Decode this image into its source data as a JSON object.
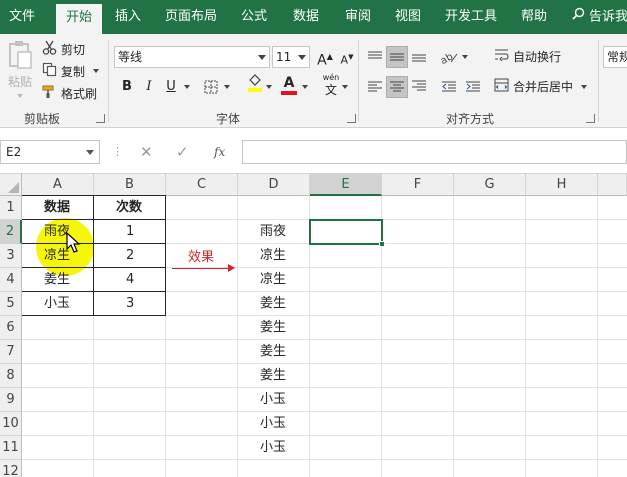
{
  "tabs": [
    "文件",
    "开始",
    "插入",
    "页面布局",
    "公式",
    "数据",
    "审阅",
    "视图",
    "开发工具",
    "帮助"
  ],
  "active_tab_index": 1,
  "tell_me": "告诉我",
  "clipboard": {
    "paste": "粘贴",
    "cut": "剪切",
    "copy": "复制",
    "format_painter": "格式刷",
    "group_label": "剪贴板"
  },
  "font": {
    "name": "等线",
    "size": "11",
    "grow": "A",
    "shrink": "A",
    "bold": "B",
    "italic": "I",
    "underline": "U",
    "font_color_letter": "A",
    "phonetic": "wén",
    "phonetic_char": "文",
    "group_label": "字体"
  },
  "alignment": {
    "wrap_text": "自动换行",
    "merge_center": "合并后居中",
    "group_label": "对齐方式"
  },
  "number": {
    "format": "常规"
  },
  "formula_bar": {
    "name_box": "E2",
    "fx": "fx",
    "value": ""
  },
  "columns": [
    "A",
    "B",
    "C",
    "D",
    "E",
    "F",
    "G",
    "H"
  ],
  "rows": [
    "1",
    "2",
    "3",
    "4",
    "5",
    "6",
    "7",
    "8",
    "9",
    "10",
    "11",
    "12"
  ],
  "table": {
    "headers": [
      "数据",
      "次数"
    ],
    "rows": [
      [
        "雨夜",
        "1"
      ],
      [
        "凉生",
        "2"
      ],
      [
        "姜生",
        "4"
      ],
      [
        "小玉",
        "3"
      ]
    ]
  },
  "arrow_label": "效果",
  "result": [
    "雨夜",
    "凉生",
    "凉生",
    "姜生",
    "姜生",
    "姜生",
    "姜生",
    "小玉",
    "小玉",
    "小玉"
  ],
  "colors": {
    "excel_green": "#217346",
    "arrow_red": "#d42424",
    "highlight_yellow": "#f5f500"
  }
}
